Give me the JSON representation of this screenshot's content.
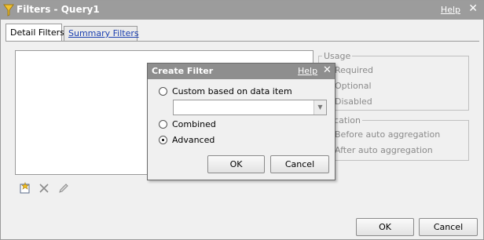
{
  "window": {
    "title": "Filters - Query1",
    "help_label": "Help",
    "close_glyph": "✕"
  },
  "tabs": [
    {
      "label": "Detail Filters",
      "active": true
    },
    {
      "label": "Summary Filters",
      "active": false
    }
  ],
  "usage": {
    "legend": "Usage",
    "options": [
      "Required",
      "Optional",
      "Disabled"
    ]
  },
  "application": {
    "legend": "plication",
    "options": [
      "Before auto aggregation",
      "After auto aggregation"
    ]
  },
  "toolbar": {
    "icons": [
      "new-filter-icon",
      "delete-icon",
      "edit-icon"
    ]
  },
  "buttons": {
    "ok": "OK",
    "cancel": "Cancel"
  },
  "dialog": {
    "title": "Create Filter",
    "help_label": "Help",
    "close_glyph": "✕",
    "options": [
      {
        "label": "Custom based on data item",
        "checked": false
      },
      {
        "label": "Combined",
        "checked": false
      },
      {
        "label": "Advanced",
        "checked": true
      }
    ],
    "combo_value": "",
    "combo_arrow": "▼",
    "ok": "OK",
    "cancel": "Cancel"
  }
}
